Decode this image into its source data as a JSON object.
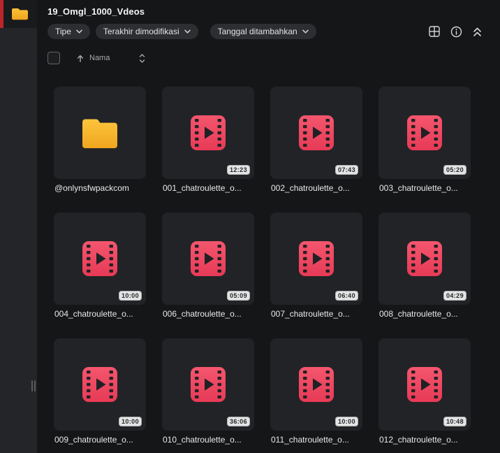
{
  "window": {
    "title": "19_Omgl_1000_Vdeos"
  },
  "sidebar": {
    "selected_item_icon": "folder-icon",
    "accent_color": "#bb262d",
    "handle_icon": "resize-handle-icon"
  },
  "filters": {
    "type_label": "Tipe",
    "modified_label": "Terakhir dimodifikasi",
    "added_label": "Tanggal ditambahkan",
    "chevron_icon": "chevron-down-icon"
  },
  "toolbar": {
    "icons": [
      "grid-view-icon",
      "info-icon",
      "collapse-icon"
    ]
  },
  "sort": {
    "direction_icon": "arrow-up-icon",
    "label": "Nama",
    "toggle_icon": "sort-updown-icon"
  },
  "colors": {
    "background": "#151618",
    "sidebar": "#232528",
    "card": "#222327",
    "accent_red": "#bb262d",
    "folder_yellow": "#f6b42a",
    "video_pink": "#ee4660",
    "badge_bg": "#e3e4e4"
  },
  "files": [
    {
      "name": "@onlynsfwpackcom",
      "type": "folder",
      "duration": ""
    },
    {
      "name": "001_chatroulette_o...",
      "type": "video",
      "duration": "12:23"
    },
    {
      "name": "002_chatroulette_o...",
      "type": "video",
      "duration": "07:43"
    },
    {
      "name": "003_chatroulette_o...",
      "type": "video",
      "duration": "05:20"
    },
    {
      "name": "004_chatroulette_o...",
      "type": "video",
      "duration": "10:00"
    },
    {
      "name": "006_chatroulette_o...",
      "type": "video",
      "duration": "05:09"
    },
    {
      "name": "007_chatroulette_o...",
      "type": "video",
      "duration": "06:40"
    },
    {
      "name": "008_chatroulette_o...",
      "type": "video",
      "duration": "04:29"
    },
    {
      "name": "009_chatroulette_o...",
      "type": "video",
      "duration": "10:00"
    },
    {
      "name": "010_chatroulette_o...",
      "type": "video",
      "duration": "36:06"
    },
    {
      "name": "011_chatroulette_o...",
      "type": "video",
      "duration": "10:00"
    },
    {
      "name": "012_chatroulette_o...",
      "type": "video",
      "duration": "10:48"
    }
  ]
}
